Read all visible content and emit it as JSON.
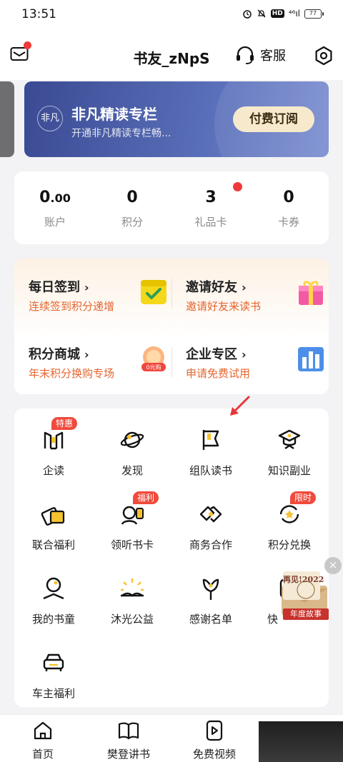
{
  "status_bar": {
    "time": "13:51",
    "hd": "HD",
    "signal": "⁴⁶ıl",
    "battery": "77"
  },
  "header": {
    "username": "书友_zNpS",
    "service_label": "客服"
  },
  "vip_card": {
    "logo": "非凡",
    "title": "非凡精读专栏",
    "subtitle": "开通非凡精读专栏畅...",
    "button": "付费订阅"
  },
  "stats": [
    {
      "value": "0",
      "value_small": ".00",
      "label": "账户"
    },
    {
      "value": "0",
      "label": "积分"
    },
    {
      "value": "3",
      "label": "礼品卡"
    },
    {
      "value": "0",
      "label": "卡券"
    }
  ],
  "activities": [
    {
      "title": "每日签到",
      "subtitle": "连续签到积分递增",
      "icon": "calendar-check-icon"
    },
    {
      "title": "邀请好友",
      "subtitle": "邀请好友来读书",
      "icon": "gift-box-icon"
    },
    {
      "title": "积分商城",
      "subtitle": "年末积分换购专场",
      "icon": "zero-yuan-coin-icon",
      "icon_text": "0元购"
    },
    {
      "title": "企业专区",
      "subtitle": "申请免费试用",
      "icon": "enterprise-building-icon"
    }
  ],
  "grid": [
    {
      "label": "企读",
      "badge": "特惠",
      "icon": "enterprise-read-icon"
    },
    {
      "label": "发现",
      "icon": "planet-icon"
    },
    {
      "label": "组队读书",
      "icon": "team-flag-icon"
    },
    {
      "label": "知识副业",
      "icon": "graduate-cap-icon"
    },
    {
      "label": "联合福利",
      "icon": "cards-icon"
    },
    {
      "label": "领听书卡",
      "badge": "福利",
      "icon": "listen-card-icon"
    },
    {
      "label": "商务合作",
      "icon": "handshake-icon"
    },
    {
      "label": "积分兑换",
      "badge": "限时",
      "icon": "points-exchange-icon"
    },
    {
      "label": "我的书童",
      "icon": "book-companion-icon"
    },
    {
      "label": "沐光公益",
      "icon": "sunrise-book-icon"
    },
    {
      "label": "感谢名单",
      "icon": "flower-icon"
    },
    {
      "label": "快",
      "icon": "quick-icon"
    },
    {
      "label": "车主福利",
      "icon": "car-icon"
    }
  ],
  "promo": {
    "year_text": "再见!2022",
    "ribbon": "年度故事",
    "close": "×"
  },
  "bottom_nav": [
    {
      "label": "首页",
      "icon": "home-icon"
    },
    {
      "label": "樊登讲书",
      "icon": "book-open-icon"
    },
    {
      "label": "免费视频",
      "icon": "video-play-icon"
    }
  ],
  "colors": {
    "accent_orange": "#e5652f",
    "badge_red": "#f04a3c",
    "vip_blue": "#3a4a93",
    "vip_button": "#f7e9cc"
  }
}
